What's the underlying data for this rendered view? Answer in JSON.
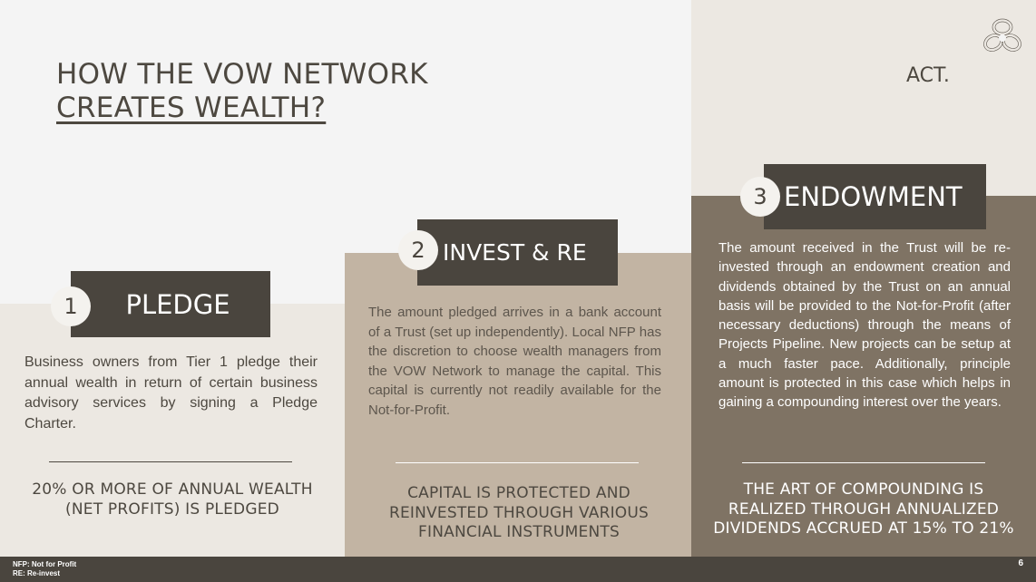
{
  "title": {
    "line1": "HOW THE VOW NETWORK",
    "line2": "CREATES WEALTH?"
  },
  "act_label": "ACT.",
  "logo_icon": "knot-logo-icon",
  "steps": [
    {
      "number": "1",
      "label": "PLEDGE",
      "description": "Business owners from Tier 1 pledge their annual wealth in return of certain business advisory services by signing a Pledge Charter.",
      "summary": "20% OR MORE  OF ANNUAL WEALTH (NET  PROFITS) IS PLEDGED"
    },
    {
      "number": "2",
      "label": "INVEST & RE",
      "description": "The amount pledged arrives in a bank account of a Trust (set up independently). Local NFP has the discretion to choose wealth managers from the VOW Network to manage the capital. This capital is currently not readily available for the Not-for-Profit.",
      "summary": "CAPITAL IS PROTECTED AND REINVESTED THROUGH VARIOUS FINANCIAL INSTRUMENTS"
    },
    {
      "number": "3",
      "label": "ENDOWMENT",
      "description": "The amount received in the Trust will be re-invested through an endowment creation and dividends obtained by the Trust on an annual basis will be provided to the Not-for-Profit (after necessary deductions) through the means of Projects Pipeline. New projects can be setup at a much faster pace. Additionally, principle amount is protected in this case which helps in gaining a compounding interest over the years.",
      "summary": "THE ART OF COMPOUNDING IS REALIZED THROUGH ANNUALIZED DIVIDENDS ACCRUED AT 15% TO 21%"
    }
  ],
  "footer": {
    "note1": "NFP: Not for Profit",
    "note2": "RE: Re-invest",
    "page_number": "6"
  },
  "colors": {
    "dark": "#4a453e",
    "tan": "#c2b4a3",
    "taupe": "#7f7364",
    "light": "#ece8e2"
  }
}
